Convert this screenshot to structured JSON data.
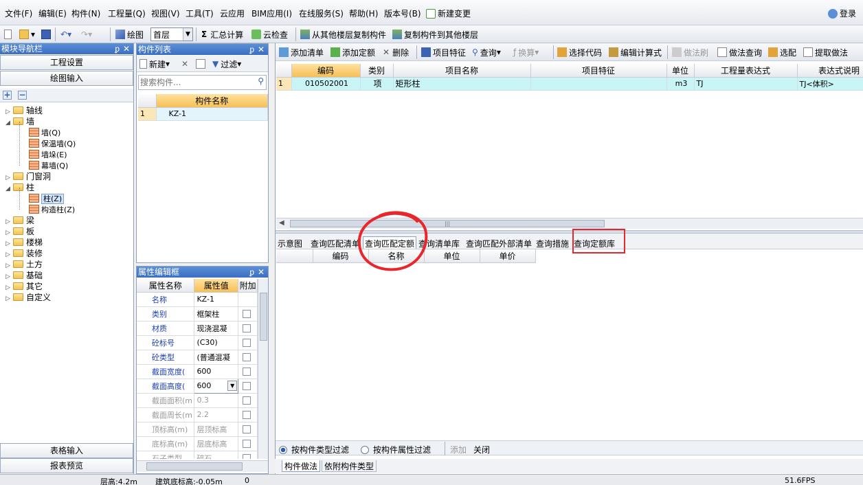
{
  "menu": [
    "文件(F)",
    "编辑(E)",
    "构件(N)",
    "工程量(Q)",
    "视图(V)",
    "工具(T)",
    "云应用",
    "BIM应用(I)",
    "在线服务(S)",
    "帮助(H)",
    "版本号(B)",
    "新建变更"
  ],
  "login_label": "登录",
  "toolbar1": {
    "draw_label": "绘图",
    "floor_value": "首层",
    "sum_calc": "汇总计算",
    "cloud_check": "云检查",
    "copy_from_floor": "从其他楼层复制构件",
    "copy_to_floor": "复制构件到其他楼层"
  },
  "nav": {
    "title": "模块导航栏",
    "project_settings": "工程设置",
    "drawing_input": "绘图输入",
    "tree": [
      {
        "label": "轴线",
        "level": 0,
        "type": "folder",
        "expanded": false
      },
      {
        "label": "墙",
        "level": 0,
        "type": "folder",
        "expanded": true
      },
      {
        "label": "墙(Q)",
        "level": 1,
        "type": "leaf"
      },
      {
        "label": "保温墙(Q)",
        "level": 1,
        "type": "leaf"
      },
      {
        "label": "墙垛(E)",
        "level": 1,
        "type": "leaf"
      },
      {
        "label": "幕墙(Q)",
        "level": 1,
        "type": "leaf"
      },
      {
        "label": "门窗洞",
        "level": 0,
        "type": "folder",
        "expanded": false
      },
      {
        "label": "柱",
        "level": 0,
        "type": "folder",
        "expanded": true
      },
      {
        "label": "柱(Z)",
        "level": 1,
        "type": "leaf",
        "selected": true
      },
      {
        "label": "构造柱(Z)",
        "level": 1,
        "type": "leaf"
      },
      {
        "label": "梁",
        "level": 0,
        "type": "folder",
        "expanded": false
      },
      {
        "label": "板",
        "level": 0,
        "type": "folder",
        "expanded": false
      },
      {
        "label": "楼梯",
        "level": 0,
        "type": "folder",
        "expanded": false
      },
      {
        "label": "装修",
        "level": 0,
        "type": "folder",
        "expanded": false
      },
      {
        "label": "土方",
        "level": 0,
        "type": "folder",
        "expanded": false
      },
      {
        "label": "基础",
        "level": 0,
        "type": "folder",
        "expanded": false
      },
      {
        "label": "其它",
        "level": 0,
        "type": "folder",
        "expanded": false
      },
      {
        "label": "自定义",
        "level": 0,
        "type": "folder",
        "expanded": false
      }
    ],
    "table_input": "表格输入",
    "report_preview": "报表预览"
  },
  "component_list": {
    "title": "构件列表",
    "new_label": "新建",
    "filter_label": "过滤",
    "search_placeholder": "搜索构件...",
    "header": "构件名称",
    "rows": [
      {
        "idx": "1",
        "name": "KZ-1"
      }
    ]
  },
  "properties": {
    "title": "属性编辑框",
    "headers": [
      "属性名称",
      "属性值",
      "附加"
    ],
    "rows": [
      {
        "name": "名称",
        "value": "KZ-1",
        "blue": true,
        "check": false
      },
      {
        "name": "类别",
        "value": "框架柱",
        "blue": true,
        "check": true
      },
      {
        "name": "材质",
        "value": "现浇混凝",
        "blue": true,
        "check": true
      },
      {
        "name": "砼标号",
        "value": "(C30)",
        "blue": true,
        "check": true
      },
      {
        "name": "砼类型",
        "value": "(普通混凝",
        "blue": true,
        "check": true
      },
      {
        "name": "截面宽度(",
        "value": "600",
        "blue": true,
        "check": true
      },
      {
        "name": "截面高度(",
        "value": "600",
        "blue": true,
        "check": true,
        "dropdown": true
      },
      {
        "name": "截面面积(m",
        "value": "0.3",
        "blue": false,
        "check": true
      },
      {
        "name": "截面周长(m",
        "value": "2.2",
        "blue": false,
        "check": true
      },
      {
        "name": "顶标高(m)",
        "value": "层顶标高",
        "blue": false,
        "check": true
      },
      {
        "name": "底标高(m)",
        "value": "层底标高",
        "blue": false,
        "check": true
      },
      {
        "name": "石子类型",
        "value": "碎石",
        "blue": false,
        "check": true
      }
    ]
  },
  "right_toolbar": {
    "add_list": "添加清单",
    "add_quota": "添加定额",
    "delete": "删除",
    "item_feature": "项目特征",
    "query": "查询",
    "convert": "换算",
    "select_code": "选择代码",
    "edit_formula": "编辑计算式",
    "method_brush": "做法刷",
    "method_query": "做法查询",
    "select_pick": "选配",
    "extract_method": "提取做法"
  },
  "main_grid": {
    "headers": [
      "编码",
      "类别",
      "项目名称",
      "项目特征",
      "单位",
      "工程量表达式",
      "表达式说明"
    ],
    "rows": [
      {
        "idx": "1",
        "code": "010502001",
        "category": "项",
        "name": "矩形柱",
        "feature": "",
        "unit": "m3",
        "expr": "TJ",
        "expr_desc": "TJ<体积>"
      }
    ]
  },
  "bottom_tabs": [
    "示意图",
    "查询匹配清单",
    "查询匹配定额",
    "查询清单库",
    "查询匹配外部清单",
    "查询措施",
    "查询定额库"
  ],
  "bottom_grid_headers": [
    "编码",
    "名称",
    "单位",
    "单价"
  ],
  "filter_bar": {
    "by_type": "按构件类型过滤",
    "by_attr": "按构件属性过滤",
    "add": "添加",
    "close": "关闭"
  },
  "sheet_tabs": [
    "构件做法",
    "依附构件类型"
  ],
  "status": {
    "floor_height": "层高:4.2m",
    "base_elev": "建筑底标高:-0.05m",
    "zero": "0",
    "fps": "51.6FPS"
  },
  "annotation_color": "#e8262b"
}
